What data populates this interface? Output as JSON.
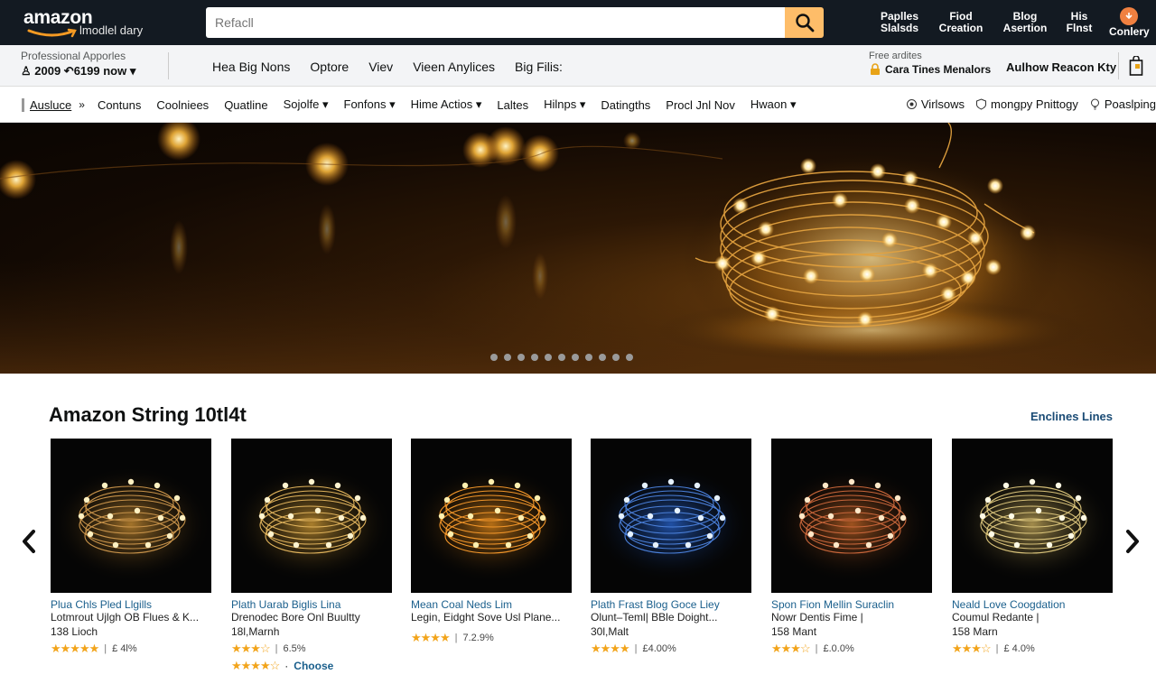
{
  "header": {
    "logo_word": "amazon",
    "logo_sub": "lmodlel dary",
    "search_placeholder": "Refacll",
    "links": [
      {
        "l1": "Paplles",
        "l2": "Slalsds"
      },
      {
        "l1": "Fiod",
        "l2": "Creation"
      },
      {
        "l1": "Blog",
        "l2": "Asertion"
      },
      {
        "l1": "His",
        "l2": "Flnst"
      },
      {
        "l1": "",
        "l2": "Conlery"
      }
    ]
  },
  "subbar": {
    "deliver_line1": "Professional Apporles",
    "deliver_line2": "♙ 2009  ↶6199 now ▾",
    "nav": [
      "Hea Big Nons",
      "Optore",
      "Viev",
      "Vieen Anylices",
      "Big Filis:"
    ],
    "promo_line1": "Free ardites",
    "promo_line2": "Cara Tines Menalors",
    "author": "Aulhow Reacon Kty"
  },
  "navrow": {
    "left": [
      "Ausluce",
      "Contuns",
      "Coolniees",
      "Quatline",
      "Sojolfe ▾",
      "Fonfons ▾",
      "Hime Actios ▾",
      "Laltes",
      "Hilnps ▾",
      "Datingths",
      "Procl Jnl Nov",
      "Hwaon ▾"
    ],
    "arrows": "»",
    "right": [
      "Virlsows",
      "mongpy Pnittogy",
      "Poaslping"
    ]
  },
  "hero": {
    "dot_count": 11
  },
  "products": {
    "title": "Amazon String 10tl4t",
    "see_more": "Enclines Lines",
    "items": [
      {
        "title": "Plua Chls Pled Llgills",
        "sub": "Lotmrout Ujlgh OB Flues & K...",
        "count": "138 Lioch",
        "stars": "★★★★★",
        "price": "£ 4l%",
        "color": "warm"
      },
      {
        "title": "Plath Uarab Biglis Lina",
        "sub": "Drenodec Bore Onl Buultty",
        "count": "18l,Marnh",
        "stars": "★★★☆",
        "price": "6.5%",
        "color": "gold",
        "extra_stars": "★★★★☆",
        "extra_label": "Choose"
      },
      {
        "title": "Mean Coal Neds Lim",
        "sub": "Legin, Eidght Sove Usl Plane...",
        "count": "",
        "stars": "★★★★",
        "price": "7.2.9%",
        "color": "amber"
      },
      {
        "title": "Plath Frast Blog Goce Liey",
        "sub": "Olunt–Teml| BBle Doight...",
        "count": "30l,Malt",
        "stars": "★★★★",
        "price": "£4.00%",
        "color": "blue"
      },
      {
        "title": "Spon Fion Mellin Suraclin",
        "sub": "Nowr Dentis Fime |",
        "count": "158 Mant",
        "stars": "★★★☆",
        "price": "£.0.0%",
        "color": "copper"
      },
      {
        "title": "Neald Love Coogdation",
        "sub": "Coumul Redante |",
        "count": "158 Marn",
        "stars": "★★★☆",
        "price": "£ 4.0%",
        "color": "pale"
      }
    ]
  },
  "colors": {
    "topbar": "#131a22",
    "accent": "#febd69",
    "link": "#1a5f8c",
    "star": "#f2a41b"
  }
}
